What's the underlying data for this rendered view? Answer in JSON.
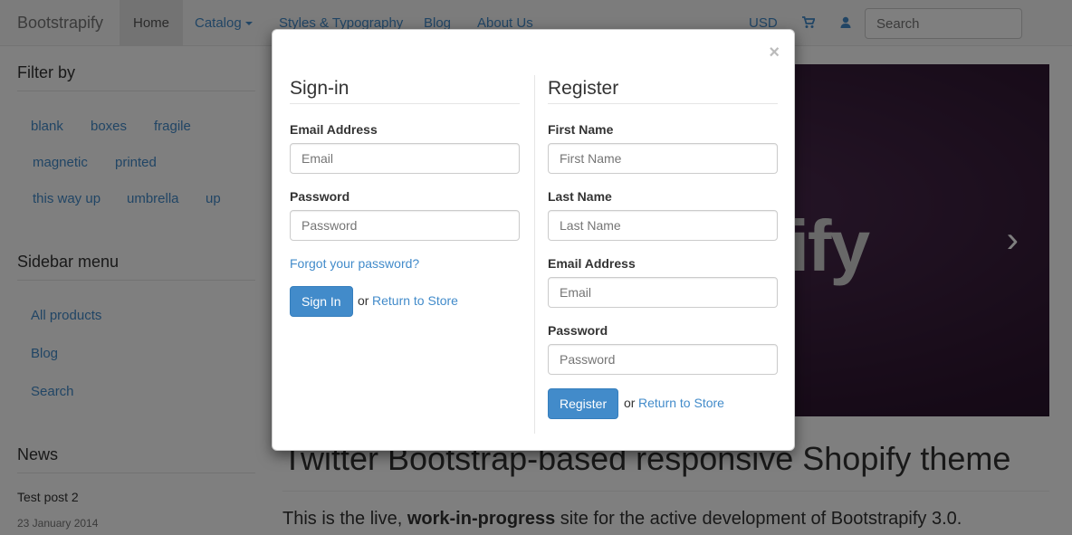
{
  "navbar": {
    "brand": "Bootstrapify",
    "items": [
      {
        "label": "Home"
      },
      {
        "label": "Catalog"
      },
      {
        "label": "Styles & Typography"
      },
      {
        "label": "Blog"
      },
      {
        "label": "About Us"
      }
    ],
    "currency": "USD",
    "search_placeholder": "Search"
  },
  "sidebar": {
    "filter_heading": "Filter by",
    "tags": [
      "blank",
      "boxes",
      "fragile",
      "magnetic",
      "printed",
      "this way up",
      "umbrella",
      "up"
    ],
    "menu_heading": "Sidebar menu",
    "menu_items": [
      "All products",
      "Blog",
      "Search"
    ],
    "news_heading": "News",
    "news_post": {
      "title": "Test post 2",
      "date": "23 January 2014"
    }
  },
  "main": {
    "carousel_text": "Bootstrapify",
    "title": "Twitter Bootstrap-based responsive Shopify theme",
    "intro_prefix": "This is the live, ",
    "intro_bold": "work-in-progress",
    "intro_suffix": " site for the active development of Bootstrapify 3.0."
  },
  "modal": {
    "close": "×",
    "signin": {
      "heading": "Sign-in",
      "email_label": "Email Address",
      "email_placeholder": "Email",
      "password_label": "Password",
      "password_placeholder": "Password",
      "forgot": "Forgot your password?",
      "button": "Sign In",
      "or": "or",
      "return_link": "Return to Store"
    },
    "register": {
      "heading": "Register",
      "first_label": "First Name",
      "first_placeholder": "First Name",
      "last_label": "Last Name",
      "last_placeholder": "Last Name",
      "email_label": "Email Address",
      "email_placeholder": "Email",
      "password_label": "Password",
      "password_placeholder": "Password",
      "button": "Register",
      "or": "or",
      "return_link": "Return to Store"
    }
  },
  "colors": {
    "link": "#428bca",
    "primary_button": "#428bca"
  }
}
